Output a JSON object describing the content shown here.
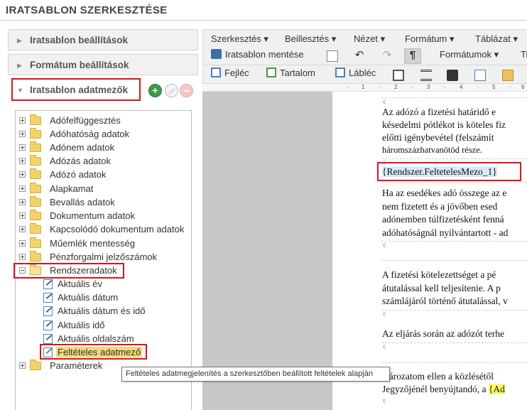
{
  "title": "IRATSABLON SZERKESZTÉSE",
  "left_panel": {
    "sections": [
      {
        "label": "Iratsablon beállítások"
      },
      {
        "label": "Formátum beállítások"
      },
      {
        "label": "Iratsablon adatmezők"
      }
    ],
    "add_glyph": "+"
  },
  "tree": {
    "folders": [
      {
        "label": "Adófelfüggesztés"
      },
      {
        "label": "Adóhatóság adatok"
      },
      {
        "label": "Adónem adatok"
      },
      {
        "label": "Adózás adatok"
      },
      {
        "label": "Adózó adatok"
      },
      {
        "label": "Alapkamat"
      },
      {
        "label": "Bevallás adatok"
      },
      {
        "label": "Dokumentum adatok"
      },
      {
        "label": "Kapcsolódó dokumentum adatok"
      },
      {
        "label": "Műemlék mentesség"
      },
      {
        "label": "Pénzforgalmi jelzőszámok"
      },
      {
        "label": "Rendszeradatok"
      }
    ],
    "rendszer_children": [
      {
        "label": "Aktuális év"
      },
      {
        "label": "Aktuális dátum"
      },
      {
        "label": "Aktuális dátum és idő"
      },
      {
        "label": "Aktuális idő"
      },
      {
        "label": "Aktuális oldalszám"
      },
      {
        "label": "Feltételes adatmező"
      }
    ],
    "last_folder": {
      "label": "Paraméterek"
    }
  },
  "tooltip": "Feltételes adatmegjelenítés a szerkesztőben beállított feltételek alapján",
  "editor": {
    "menu": [
      "Szerkesztés ▾",
      "Beillesztés ▾",
      "Nézet ▾",
      "Formátum ▾",
      "Táblázat ▾"
    ],
    "toolbar1": {
      "save_label": "Iratsablon mentése",
      "undo": "↶",
      "redo": "↷",
      "pilcrow": "¶",
      "formats_label": "Formátumok ▾",
      "truncated": "Ti"
    },
    "toolbar2": {
      "header_label": "Fejléc",
      "content_label": "Tartalom",
      "footer_label": "Lábléc"
    },
    "ruler": [
      "·",
      "1",
      "·",
      "2",
      "·",
      "3",
      "·",
      "4",
      "·",
      "5",
      "·",
      "6",
      "·"
    ],
    "para_mark": "€",
    "lines": {
      "p1": [
        "Az adózó a fizetési határidő e",
        "késedelmi pótlékot is köteles fiz",
        "előtti igénybevétel (felszámít",
        "háromszázhatvanötöd része."
      ],
      "field": "{Rendszer.FeltetelesMezo_1}",
      "p2": [
        "Ha az esedékes adó összege az e",
        "nem fizetett és a jövőben esed",
        "adónemben túlfizetésként fenná",
        "adóhatóságnál nyilvántartott - ad"
      ],
      "p3": [
        "A fizetési kötelezettséget a pé",
        "átutalással kell teljesítenie. A p",
        "számlájáról történő átutalással, v"
      ],
      "p4": [
        "Az eljárás során az adózót terhe"
      ],
      "p5a": "atározatom ellen a közlésétől",
      "p5b_prefix": "Jegyzőjénél benyújtandó, a ",
      "p5b_highlight": "{Ad"
    }
  }
}
